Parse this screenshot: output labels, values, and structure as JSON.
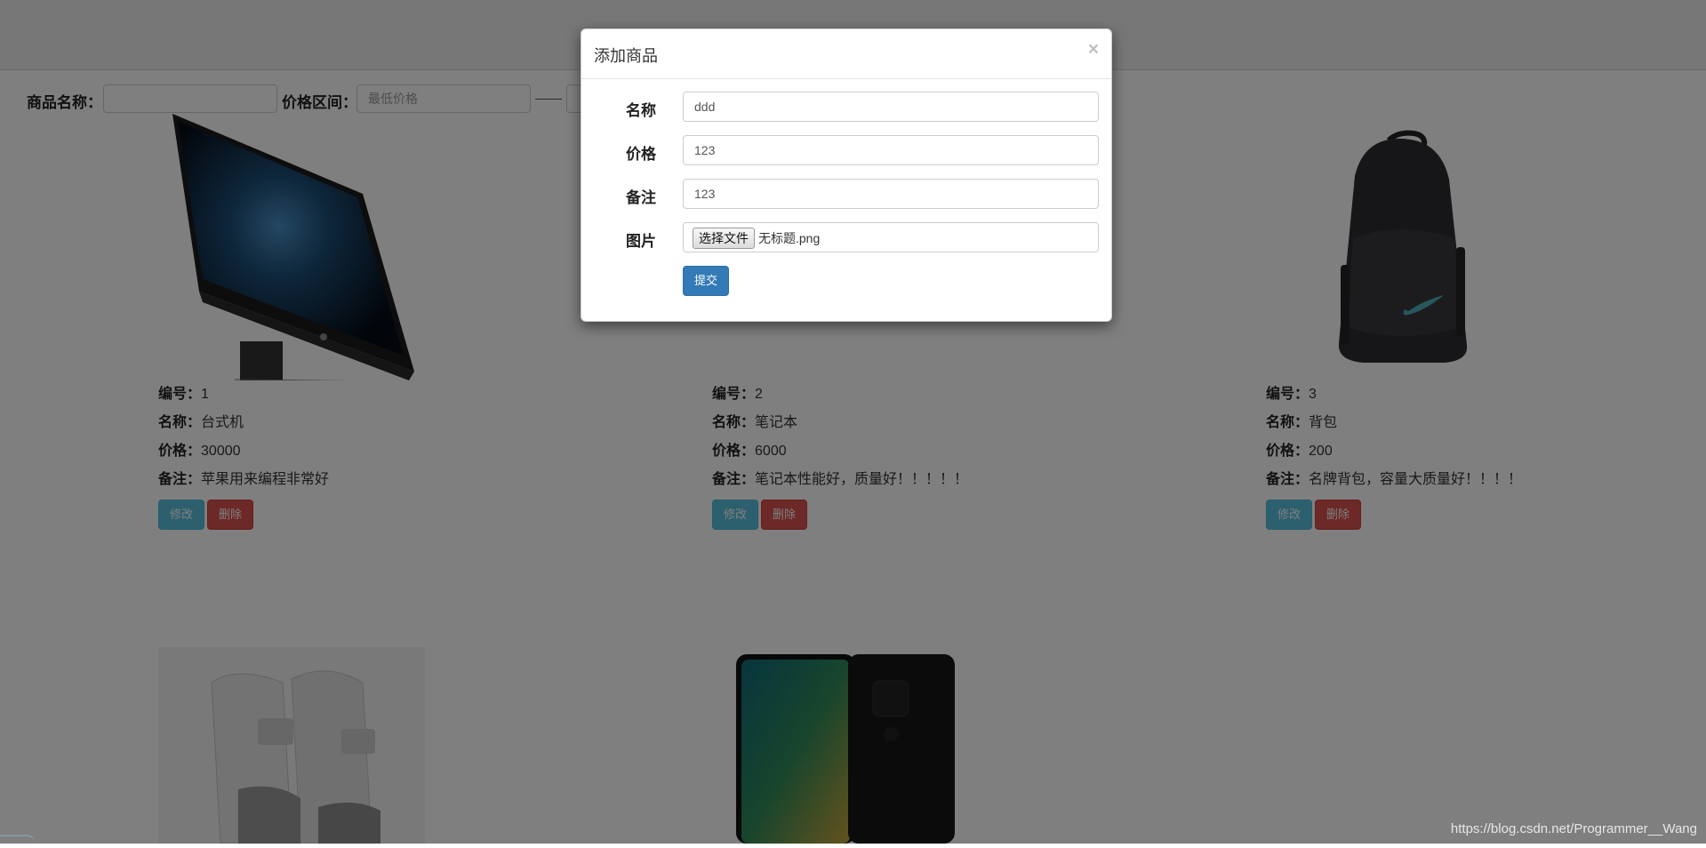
{
  "filter": {
    "name_label": "商品名称：",
    "name_value": "",
    "price_label": "价格区间：",
    "min_placeholder": "最低价格"
  },
  "products": [
    {
      "id_label": "编号：",
      "id": "1",
      "name_label": "名称：",
      "name": "台式机",
      "price_label": "价格：",
      "price": "30000",
      "note_label": "备注：",
      "note": "苹果用来编程非常好",
      "edit_label": "修改",
      "delete_label": "删除"
    },
    {
      "id_label": "编号：",
      "id": "2",
      "name_label": "名称：",
      "name": "笔记本",
      "price_label": "价格：",
      "price": "6000",
      "note_label": "备注：",
      "note": "笔记本性能好，质量好！！！！！",
      "edit_label": "修改",
      "delete_label": "删除"
    },
    {
      "id_label": "编号：",
      "id": "3",
      "name_label": "名称：",
      "name": "背包",
      "price_label": "价格：",
      "price": "200",
      "note_label": "备注：",
      "note": "名牌背包，容量大质量好！！！！",
      "edit_label": "修改",
      "delete_label": "删除"
    }
  ],
  "modal": {
    "title": "添加商品",
    "close": "×",
    "fields": {
      "name_label": "名称",
      "name_value": "ddd",
      "price_label": "价格",
      "price_value": "123",
      "note_label": "备注",
      "note_value": "123",
      "image_label": "图片",
      "file_button": "选择文件",
      "file_name": "无标题.png"
    },
    "submit_label": "提交"
  },
  "watermark": "https://blog.csdn.net/Programmer__Wang",
  "colors": {
    "info": "#5bc0de",
    "danger": "#d9534f",
    "primary": "#337ab7"
  }
}
